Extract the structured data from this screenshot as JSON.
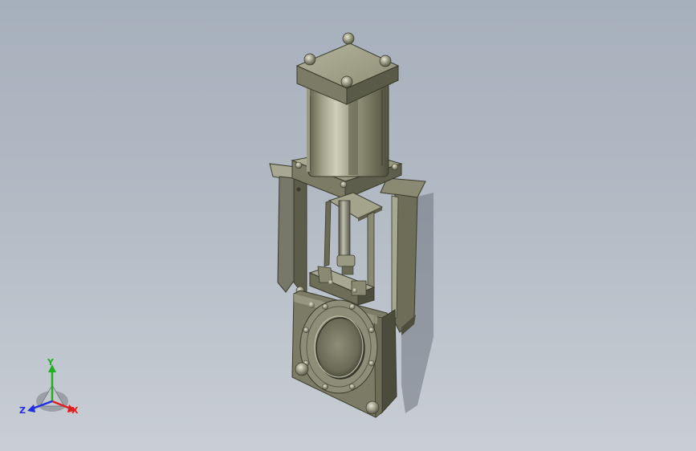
{
  "viewport": {
    "background_top": "#a6b0bc",
    "background_bottom": "#c9ced5"
  },
  "model": {
    "body_color": "#7a7a62",
    "highlight_color": "#c8c8b2",
    "shadow_color": "#3a3a2c",
    "cylinder_color": "#8c8c74"
  },
  "triad": {
    "x_label": "X",
    "y_label": "Y",
    "z_label": "Z",
    "x_color": "#e02020",
    "y_color": "#20b020",
    "z_color": "#2030e0"
  }
}
